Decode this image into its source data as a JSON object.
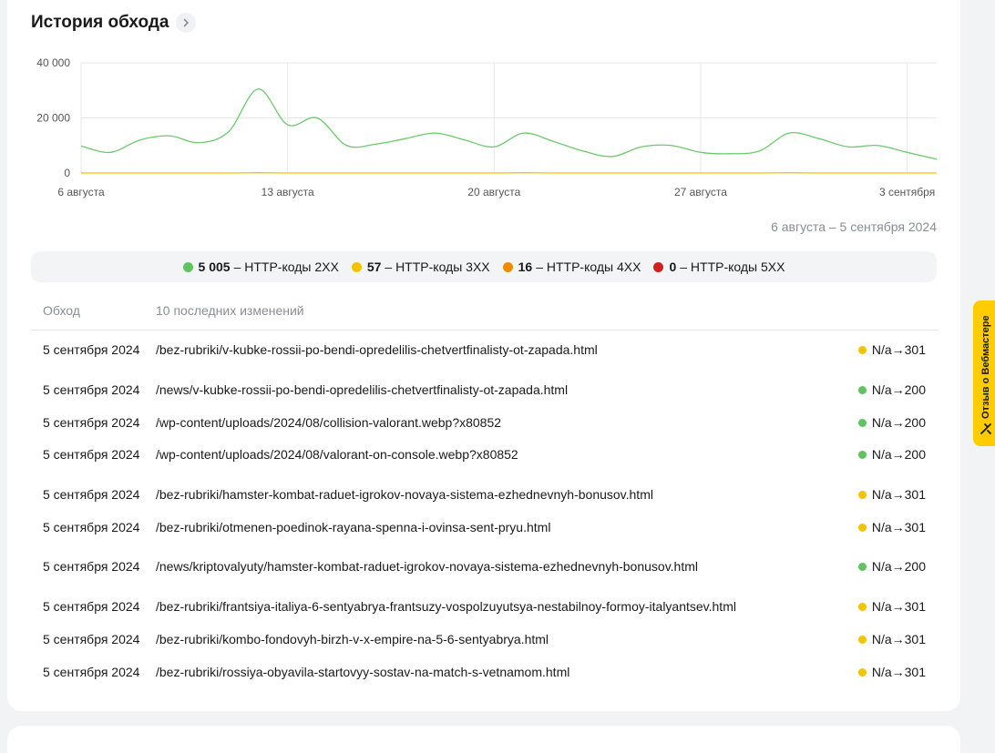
{
  "header": {
    "title": "История обхода"
  },
  "chart_data": {
    "type": "line",
    "x_ticks": [
      "6 августа",
      "13 августа",
      "20 августа",
      "27 августа",
      "3 сентября"
    ],
    "y_ticks": [
      "40 000",
      "20 000",
      "0"
    ],
    "ylim": [
      0,
      40000
    ],
    "x_range": [
      "2024-08-06",
      "2024-09-05"
    ],
    "series": [
      {
        "color": "#6cc96c",
        "values": [
          9800,
          7500,
          12000,
          13500,
          11000,
          15000,
          30500,
          17500,
          20000,
          10000,
          10500,
          12500,
          14500,
          12000,
          9500,
          14500,
          11500,
          8000,
          6000,
          9500,
          10000,
          7500,
          7000,
          8000,
          14500,
          12500,
          9500,
          10000,
          7500,
          5000
        ]
      },
      {
        "color": "#f5c200",
        "values": [
          0,
          0,
          0,
          0,
          0,
          0,
          100,
          0,
          0,
          0,
          0,
          0,
          0,
          0,
          0,
          100,
          0,
          0,
          0,
          0,
          0,
          0,
          0,
          0,
          100,
          0,
          0,
          0,
          0,
          0
        ]
      }
    ]
  },
  "date_range": "6 августа – 5 сентября 2024",
  "legend": [
    {
      "value": "5 005",
      "label": "– HTTP-коды 2XX",
      "color": "#5fc35f"
    },
    {
      "value": "57",
      "label": "– HTTP-коды 3XX",
      "color": "#f5c200"
    },
    {
      "value": "16",
      "label": "– HTTP-коды 4XX",
      "color": "#ee8b00"
    },
    {
      "value": "0",
      "label": "– HTTP-коды 5XX",
      "color": "#d0201b"
    }
  ],
  "table": {
    "col_crawl": "Обход",
    "col_changes": "10 последних изменений",
    "rows": [
      {
        "date": "5 сентября 2024",
        "url": "/bez-rubriki/v-kubke-rossii-po-bendi-opredelilis-chetvertfinalisty-ot-zapada.html",
        "status": "N/a→301",
        "color": "#f5c200"
      },
      {
        "date": "5 сентября 2024",
        "url": "/news/v-kubke-rossii-po-bendi-opredelilis-chetvertfinalisty-ot-zapada.html",
        "status": "N/a→200",
        "color": "#5fc35f"
      },
      {
        "date": "5 сентября 2024",
        "url": "/wp-content/uploads/2024/08/collision-valorant.webp?x80852",
        "status": "N/a→200",
        "color": "#5fc35f"
      },
      {
        "date": "5 сентября 2024",
        "url": "/wp-content/uploads/2024/08/valorant-on-console.webp?x80852",
        "status": "N/a→200",
        "color": "#5fc35f"
      },
      {
        "date": "5 сентября 2024",
        "url": "/bez-rubriki/hamster-kombat-raduet-igrokov-novaya-sistema-ezhednevnyh-bonusov.html",
        "status": "N/a→301",
        "color": "#f5c200"
      },
      {
        "date": "5 сентября 2024",
        "url": "/bez-rubriki/otmenen-poedinok-rayana-spenna-i-ovinsa-sent-pryu.html",
        "status": "N/a→301",
        "color": "#f5c200"
      },
      {
        "date": "5 сентября 2024",
        "url": "/news/kriptovalyuty/hamster-kombat-raduet-igrokov-novaya-sistema-ezhednevnyh-bonusov.html",
        "status": "N/a→200",
        "color": "#5fc35f"
      },
      {
        "date": "5 сентября 2024",
        "url": "/bez-rubriki/frantsiya-italiya-6-sentyabrya-frantsuzy-vospolzuyutsya-nestabilnoy-formoy-italyantsev.html",
        "status": "N/a→301",
        "color": "#f5c200"
      },
      {
        "date": "5 сентября 2024",
        "url": "/bez-rubriki/kombo-fondovyh-birzh-v-x-empire-na-5-6-sentyabrya.html",
        "status": "N/a→301",
        "color": "#f5c200"
      },
      {
        "date": "5 сентября 2024",
        "url": "/bez-rubriki/rossiya-obyavila-startovyy-sostav-na-match-s-vetnamom.html",
        "status": "N/a→301",
        "color": "#f5c200"
      }
    ]
  },
  "feedback": {
    "label": "Отзыв о Вебмастере",
    "icon": "tools-icon"
  }
}
